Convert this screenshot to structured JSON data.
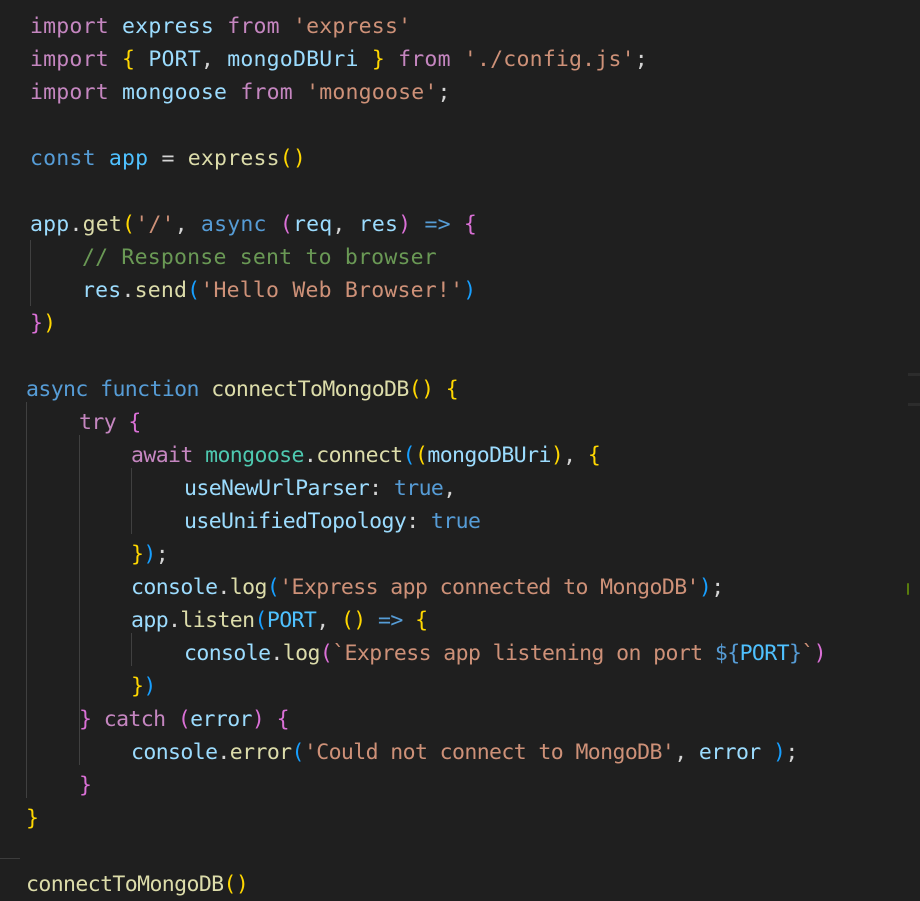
{
  "editor": {
    "language": "javascript",
    "lines": [
      {
        "indent": 0,
        "tokens": [
          {
            "t": "import",
            "c": "tok-kw"
          },
          {
            "t": " "
          },
          {
            "t": "express",
            "c": "tok-var"
          },
          {
            "t": " "
          },
          {
            "t": "from",
            "c": "tok-kw"
          },
          {
            "t": " "
          },
          {
            "t": "'express'",
            "c": "tok-str"
          }
        ]
      },
      {
        "indent": 0,
        "tokens": [
          {
            "t": "import",
            "c": "tok-kw"
          },
          {
            "t": " "
          },
          {
            "t": "{",
            "c": "b1"
          },
          {
            "t": " "
          },
          {
            "t": "PORT",
            "c": "tok-var"
          },
          {
            "t": ", ",
            "c": "tok-plain"
          },
          {
            "t": "mongoDBUri",
            "c": "tok-var"
          },
          {
            "t": " "
          },
          {
            "t": "}",
            "c": "b1"
          },
          {
            "t": " "
          },
          {
            "t": "from",
            "c": "tok-kw"
          },
          {
            "t": " "
          },
          {
            "t": "'./config.js'",
            "c": "tok-str"
          },
          {
            "t": ";",
            "c": "tok-plain"
          }
        ]
      },
      {
        "indent": 0,
        "tokens": [
          {
            "t": "import",
            "c": "tok-kw"
          },
          {
            "t": " "
          },
          {
            "t": "mongoose",
            "c": "tok-var"
          },
          {
            "t": " "
          },
          {
            "t": "from",
            "c": "tok-kw"
          },
          {
            "t": " "
          },
          {
            "t": "'mongoose'",
            "c": "tok-str"
          },
          {
            "t": ";",
            "c": "tok-plain"
          }
        ]
      },
      {
        "indent": 0,
        "tokens": []
      },
      {
        "indent": 0,
        "tokens": [
          {
            "t": "const",
            "c": "tok-decl"
          },
          {
            "t": " "
          },
          {
            "t": "app",
            "c": "tok-const"
          },
          {
            "t": " = ",
            "c": "tok-plain"
          },
          {
            "t": "express",
            "c": "tok-fn"
          },
          {
            "t": "()",
            "c": "b1"
          }
        ]
      },
      {
        "indent": 0,
        "tokens": []
      },
      {
        "indent": 0,
        "tokens": [
          {
            "t": "app",
            "c": "tok-var"
          },
          {
            "t": ".",
            "c": "tok-plain"
          },
          {
            "t": "get",
            "c": "tok-fn"
          },
          {
            "t": "(",
            "c": "b1"
          },
          {
            "t": "'/'",
            "c": "tok-str"
          },
          {
            "t": ", ",
            "c": "tok-plain"
          },
          {
            "t": "async",
            "c": "tok-decl"
          },
          {
            "t": " "
          },
          {
            "t": "(",
            "c": "b2"
          },
          {
            "t": "req",
            "c": "tok-var"
          },
          {
            "t": ", ",
            "c": "tok-plain"
          },
          {
            "t": "res",
            "c": "tok-var"
          },
          {
            "t": ")",
            "c": "b2"
          },
          {
            "t": " "
          },
          {
            "t": "=>",
            "c": "tok-decl"
          },
          {
            "t": " "
          },
          {
            "t": "{",
            "c": "b2"
          }
        ]
      },
      {
        "indent": 1,
        "tokens": [
          {
            "t": "// Response sent to browser",
            "c": "tok-cmt"
          }
        ]
      },
      {
        "indent": 1,
        "tokens": [
          {
            "t": "res",
            "c": "tok-var"
          },
          {
            "t": ".",
            "c": "tok-plain"
          },
          {
            "t": "send",
            "c": "tok-fn"
          },
          {
            "t": "(",
            "c": "b3"
          },
          {
            "t": "'Hello Web Browser!'",
            "c": "tok-str"
          },
          {
            "t": ")",
            "c": "b3"
          }
        ]
      },
      {
        "indent": 0,
        "tokens": [
          {
            "t": "}",
            "c": "b2"
          },
          {
            "t": ")",
            "c": "b1"
          }
        ]
      },
      {
        "indent": 0,
        "tokens": []
      },
      {
        "indent": 0,
        "tokens": [
          {
            "t": "async",
            "c": "tok-decl"
          },
          {
            "t": " "
          },
          {
            "t": "function",
            "c": "tok-decl"
          },
          {
            "t": " "
          },
          {
            "t": "connectToMongoDB",
            "c": "tok-fn"
          },
          {
            "t": "()",
            "c": "b1"
          },
          {
            "t": " "
          },
          {
            "t": "{",
            "c": "b1"
          }
        ]
      },
      {
        "indent": 1,
        "tokens": [
          {
            "t": "try",
            "c": "tok-kw"
          },
          {
            "t": " "
          },
          {
            "t": "{",
            "c": "b2"
          }
        ]
      },
      {
        "indent": 2,
        "tokens": [
          {
            "t": "await",
            "c": "tok-kw"
          },
          {
            "t": " "
          },
          {
            "t": "mongoose",
            "c": "tok-obj"
          },
          {
            "t": ".",
            "c": "tok-plain"
          },
          {
            "t": "connect",
            "c": "tok-fn"
          },
          {
            "t": "(",
            "c": "b3"
          },
          {
            "t": "(",
            "c": "b1"
          },
          {
            "t": "mongoDBUri",
            "c": "tok-var"
          },
          {
            "t": ")",
            "c": "b1"
          },
          {
            "t": ", ",
            "c": "tok-plain"
          },
          {
            "t": "{",
            "c": "b1"
          }
        ]
      },
      {
        "indent": 3,
        "tokens": [
          {
            "t": "useNewUrlParser",
            "c": "tok-var"
          },
          {
            "t": ": ",
            "c": "tok-plain"
          },
          {
            "t": "true",
            "c": "tok-decl"
          },
          {
            "t": ",",
            "c": "tok-plain"
          }
        ]
      },
      {
        "indent": 3,
        "tokens": [
          {
            "t": "useUnifiedTopology",
            "c": "tok-var"
          },
          {
            "t": ": ",
            "c": "tok-plain"
          },
          {
            "t": "true",
            "c": "tok-decl"
          }
        ]
      },
      {
        "indent": 2,
        "tokens": [
          {
            "t": "}",
            "c": "b1"
          },
          {
            "t": ")",
            "c": "b3"
          },
          {
            "t": ";",
            "c": "tok-plain"
          }
        ]
      },
      {
        "indent": 2,
        "tokens": [
          {
            "t": "console",
            "c": "tok-var"
          },
          {
            "t": ".",
            "c": "tok-plain"
          },
          {
            "t": "log",
            "c": "tok-fn"
          },
          {
            "t": "(",
            "c": "b3"
          },
          {
            "t": "'Express app connected to MongoDB'",
            "c": "tok-str"
          },
          {
            "t": ")",
            "c": "b3"
          },
          {
            "t": ";",
            "c": "tok-plain"
          }
        ]
      },
      {
        "indent": 2,
        "tokens": [
          {
            "t": "app",
            "c": "tok-var"
          },
          {
            "t": ".",
            "c": "tok-plain"
          },
          {
            "t": "listen",
            "c": "tok-fn"
          },
          {
            "t": "(",
            "c": "b3"
          },
          {
            "t": "PORT",
            "c": "tok-const"
          },
          {
            "t": ", ",
            "c": "tok-plain"
          },
          {
            "t": "()",
            "c": "b1"
          },
          {
            "t": " "
          },
          {
            "t": "=>",
            "c": "tok-decl"
          },
          {
            "t": " "
          },
          {
            "t": "{",
            "c": "b1"
          }
        ]
      },
      {
        "indent": 3,
        "tokens": [
          {
            "t": "console",
            "c": "tok-var"
          },
          {
            "t": ".",
            "c": "tok-plain"
          },
          {
            "t": "log",
            "c": "tok-fn"
          },
          {
            "t": "(",
            "c": "b2"
          },
          {
            "t": "`Express app listening on port ",
            "c": "tok-str"
          },
          {
            "t": "${",
            "c": "tok-decl"
          },
          {
            "t": "PORT",
            "c": "tok-const"
          },
          {
            "t": "}",
            "c": "tok-decl"
          },
          {
            "t": "`",
            "c": "tok-str"
          },
          {
            "t": ")",
            "c": "b2"
          }
        ]
      },
      {
        "indent": 2,
        "tokens": [
          {
            "t": "}",
            "c": "b1"
          },
          {
            "t": ")",
            "c": "b3"
          }
        ]
      },
      {
        "indent": 1,
        "tokens": [
          {
            "t": "}",
            "c": "b2"
          },
          {
            "t": " "
          },
          {
            "t": "catch",
            "c": "tok-kw"
          },
          {
            "t": " "
          },
          {
            "t": "(",
            "c": "b2"
          },
          {
            "t": "error",
            "c": "tok-var"
          },
          {
            "t": ")",
            "c": "b2"
          },
          {
            "t": " "
          },
          {
            "t": "{",
            "c": "b2"
          }
        ]
      },
      {
        "indent": 2,
        "tokens": [
          {
            "t": "console",
            "c": "tok-var"
          },
          {
            "t": ".",
            "c": "tok-plain"
          },
          {
            "t": "error",
            "c": "tok-fn"
          },
          {
            "t": "(",
            "c": "b3"
          },
          {
            "t": "'Could not connect to MongoDB'",
            "c": "tok-str"
          },
          {
            "t": ", ",
            "c": "tok-plain"
          },
          {
            "t": "error",
            "c": "tok-var"
          },
          {
            "t": " "
          },
          {
            "t": ")",
            "c": "b3"
          },
          {
            "t": ";",
            "c": "tok-plain"
          }
        ]
      },
      {
        "indent": 1,
        "tokens": [
          {
            "t": "}",
            "c": "b2"
          }
        ]
      },
      {
        "indent": 0,
        "tokens": [
          {
            "t": "}",
            "c": "b1"
          }
        ]
      },
      {
        "indent": 0,
        "tokens": []
      },
      {
        "indent": 0,
        "tokens": [
          {
            "t": "connectToMongoDB",
            "c": "tok-fn"
          },
          {
            "t": "()",
            "c": "b1"
          }
        ]
      }
    ]
  }
}
